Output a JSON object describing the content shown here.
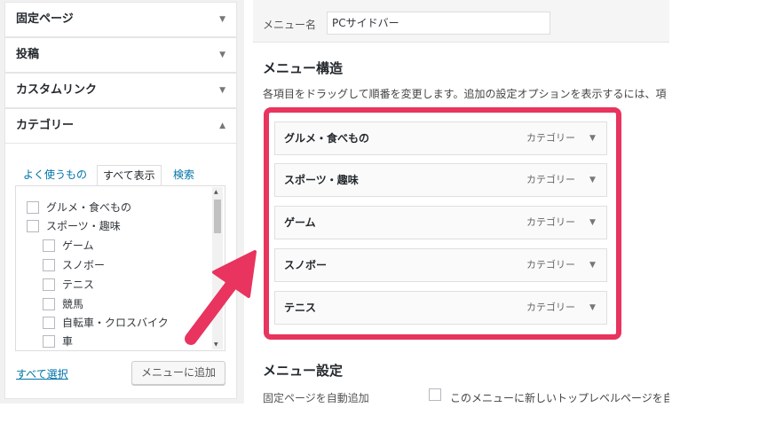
{
  "sidebar": {
    "sections": [
      {
        "label": "固定ページ",
        "arrow": "▼"
      },
      {
        "label": "投稿",
        "arrow": "▼"
      },
      {
        "label": "カスタムリンク",
        "arrow": "▼"
      },
      {
        "label": "カテゴリー",
        "arrow": "▲"
      }
    ],
    "tabs": [
      "よく使うもの",
      "すべて表示",
      "検索"
    ],
    "categories": [
      {
        "label": "グルメ・食べもの"
      },
      {
        "label": "スポーツ・趣味"
      },
      {
        "label": "ゲーム"
      },
      {
        "label": "スノボー"
      },
      {
        "label": "テニス"
      },
      {
        "label": "競馬"
      },
      {
        "label": "自転車・クロスバイク"
      },
      {
        "label": "車"
      }
    ],
    "select_all": "すべて選択",
    "add_button": "メニューに追加"
  },
  "editor": {
    "menu_name_label": "メニュー名",
    "menu_name_value": "PCサイドバー",
    "structure_heading": "メニュー構造",
    "structure_desc": "各項目をドラッグして順番を変更します。追加の設定オプションを表示するには、項",
    "items": [
      {
        "title": "グルメ・食べもの",
        "type": "カテゴリー"
      },
      {
        "title": "スポーツ・趣味",
        "type": "カテゴリー"
      },
      {
        "title": "ゲーム",
        "type": "カテゴリー"
      },
      {
        "title": "スノボー",
        "type": "カテゴリー"
      },
      {
        "title": "テニス",
        "type": "カテゴリー"
      }
    ],
    "settings_heading": "メニュー設定",
    "auto_add_label": "固定ページを自動追加",
    "auto_add_text": "このメニューに新しいトップレベルページを自",
    "item_toggle": "▼"
  },
  "colors": {
    "highlight": "#e8345e",
    "link": "#0073aa"
  }
}
